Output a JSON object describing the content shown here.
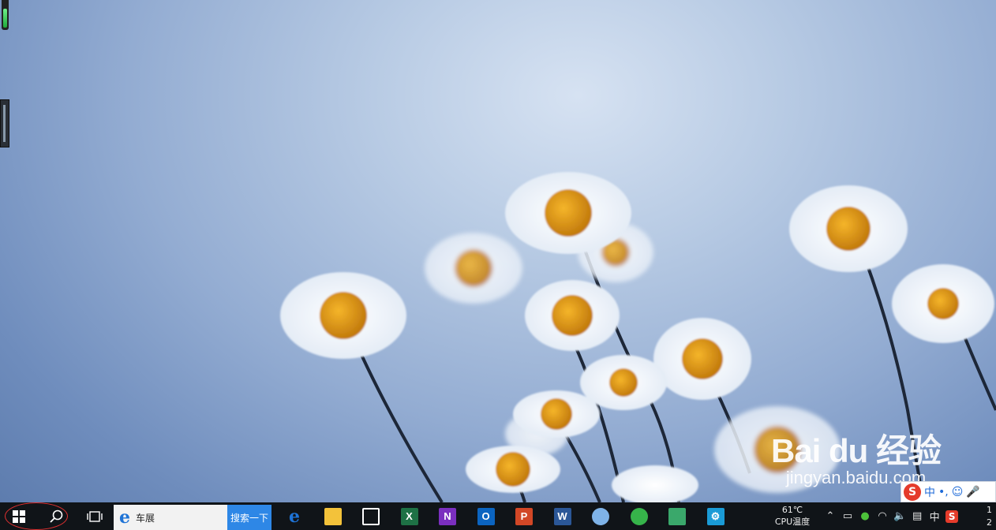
{
  "desktop": {
    "wallpaper": "daisies-on-blue",
    "watermark": {
      "logo": "Bai du 经验",
      "url": "jingyan.baidu.com"
    }
  },
  "taskbar": {
    "start_icon": "windows-logo-icon",
    "search_icon": "magnifier-icon",
    "task_view_icon": "task-view-icon",
    "search_box": {
      "text": "车展",
      "button_label": "搜索一下",
      "browser_icon": "ie-icon"
    },
    "apps": [
      {
        "name": "edge",
        "letter": "e",
        "color": "#1e73d6"
      },
      {
        "name": "file-explorer",
        "letter": "",
        "color": "#f3c23a"
      },
      {
        "name": "store",
        "letter": "",
        "color": "#ffffff"
      },
      {
        "name": "excel",
        "letter": "X",
        "color": "#1e7145"
      },
      {
        "name": "onenote",
        "letter": "N",
        "color": "#7b2fbf"
      },
      {
        "name": "outlook",
        "letter": "O",
        "color": "#0b64c0"
      },
      {
        "name": "powerpoint",
        "letter": "P",
        "color": "#d24726"
      },
      {
        "name": "word",
        "letter": "W",
        "color": "#2b5797"
      },
      {
        "name": "paint",
        "letter": "",
        "color": "#7fb3e8"
      },
      {
        "name": "refresh-app",
        "letter": "",
        "color": "#36b44a"
      },
      {
        "name": "photos-app",
        "letter": "",
        "color": "#3aa86b"
      },
      {
        "name": "settings",
        "letter": "⚙",
        "color": "#1a9bd6"
      }
    ],
    "cpu_temp": {
      "value": "61℃",
      "label": "CPU温度"
    },
    "tray": {
      "ime_lang": "中",
      "sogou": "S"
    },
    "clock": {
      "line1": "1",
      "line2": "2"
    }
  },
  "ime_bar": {
    "lang": "中",
    "punct": "•,",
    "logo": "S"
  }
}
